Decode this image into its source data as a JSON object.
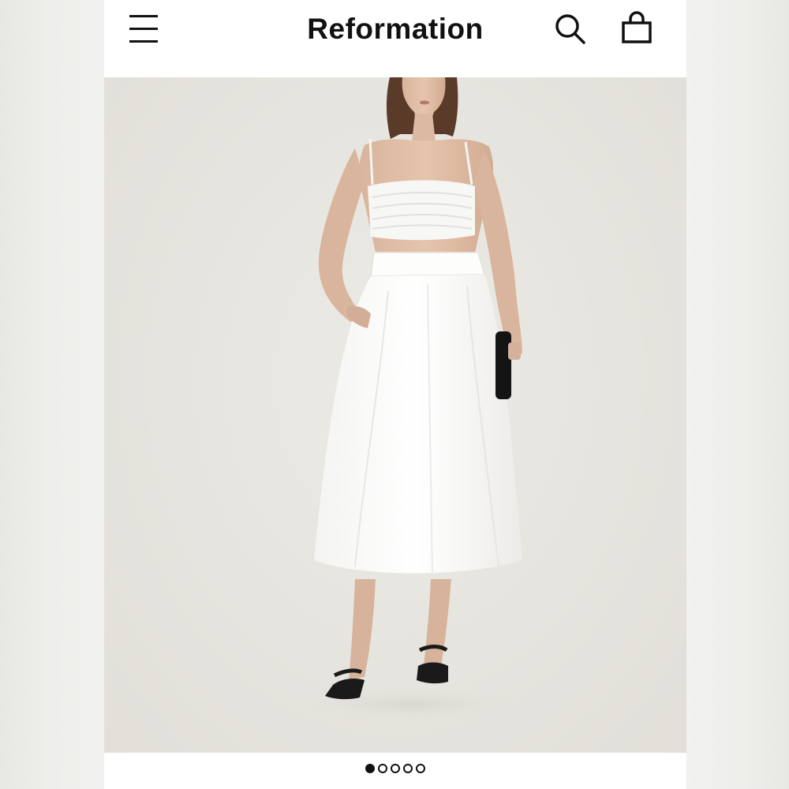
{
  "header": {
    "brand": "Reformation",
    "menu_icon": "hamburger-menu-icon",
    "search_icon": "search-icon",
    "bag_icon": "shopping-bag-icon"
  },
  "gallery": {
    "image_subject": "Model wearing white cropped top and white midi skirt",
    "total_images": 5,
    "active_index": 0
  },
  "colors": {
    "background": "#f1f1ef",
    "text": "#111111",
    "hero_backdrop": "#e6e4de"
  }
}
